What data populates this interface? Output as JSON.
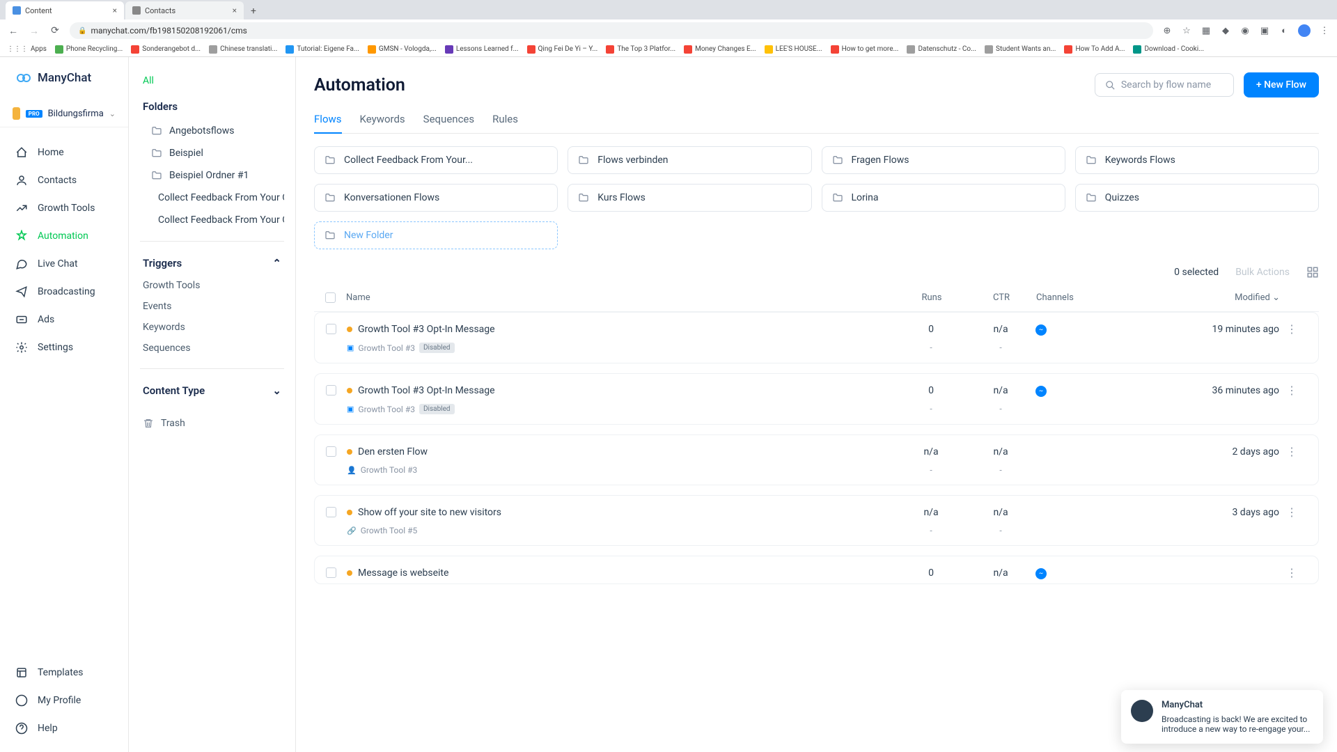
{
  "browser": {
    "tabs": [
      {
        "title": "Content",
        "active": true
      },
      {
        "title": "Contacts",
        "active": false
      }
    ],
    "url": "manychat.com/fb198150208192061/cms",
    "bookmarks": [
      {
        "label": "Apps",
        "color": "#5f6368"
      },
      {
        "label": "Phone Recycling...",
        "color": "#4CAF50"
      },
      {
        "label": "Sonderangebot d...",
        "color": "#f44336"
      },
      {
        "label": "Chinese translati...",
        "color": "#9e9e9e"
      },
      {
        "label": "Tutorial: Eigene Fa...",
        "color": "#2196F3"
      },
      {
        "label": "GMSN - Vologda,...",
        "color": "#ff9800"
      },
      {
        "label": "Lessons Learned f...",
        "color": "#673AB7"
      },
      {
        "label": "Qing Fei De Yi – Y...",
        "color": "#f44336"
      },
      {
        "label": "The Top 3 Platfor...",
        "color": "#f44336"
      },
      {
        "label": "Money Changes E...",
        "color": "#f44336"
      },
      {
        "label": "LEE'S HOUSE...",
        "color": "#ffc107"
      },
      {
        "label": "How to get more...",
        "color": "#f44336"
      },
      {
        "label": "Datenschutz - Co...",
        "color": "#9e9e9e"
      },
      {
        "label": "Student Wants an...",
        "color": "#9e9e9e"
      },
      {
        "label": "How To Add A...",
        "color": "#f44336"
      },
      {
        "label": "Download - Cooki...",
        "color": "#009688"
      }
    ]
  },
  "app": {
    "logo": "ManyChat",
    "workspace": {
      "name": "Bildungsfirma",
      "badge": "PRO"
    },
    "nav": [
      {
        "label": "Home",
        "icon": "home"
      },
      {
        "label": "Contacts",
        "icon": "contacts"
      },
      {
        "label": "Growth Tools",
        "icon": "growth"
      },
      {
        "label": "Automation",
        "icon": "automation",
        "active": true
      },
      {
        "label": "Live Chat",
        "icon": "chat"
      },
      {
        "label": "Broadcasting",
        "icon": "broadcast"
      },
      {
        "label": "Ads",
        "icon": "ads"
      },
      {
        "label": "Settings",
        "icon": "settings"
      }
    ],
    "nav_bottom": [
      {
        "label": "Templates",
        "icon": "templates"
      },
      {
        "label": "My Profile",
        "icon": "profile"
      },
      {
        "label": "Help",
        "icon": "help"
      }
    ]
  },
  "folder_bar": {
    "all": "All",
    "folders_heading": "Folders",
    "folders": [
      "Angebotsflows",
      "Beispiel",
      "Beispiel Ordner #1",
      "Collect Feedback From Your Cu",
      "Collect Feedback From Your Cu"
    ],
    "triggers_heading": "Triggers",
    "triggers": [
      "Growth Tools",
      "Events",
      "Keywords",
      "Sequences"
    ],
    "content_type_heading": "Content Type",
    "trash": "Trash"
  },
  "main": {
    "title": "Automation",
    "search_placeholder": "Search by flow name",
    "new_flow": "+ New Flow",
    "tabs": [
      "Flows",
      "Keywords",
      "Sequences",
      "Rules"
    ],
    "folder_cards": [
      "Collect Feedback From Your...",
      "Flows verbinden",
      "Fragen Flows",
      "Keywords Flows",
      "Konversationen Flows",
      "Kurs Flows",
      "Lorina",
      "Quizzes"
    ],
    "new_folder": "New Folder",
    "selected_text": "0 selected",
    "bulk_actions": "Bulk Actions",
    "columns": {
      "name": "Name",
      "runs": "Runs",
      "ctr": "CTR",
      "channels": "Channels",
      "modified": "Modified"
    },
    "flows": [
      {
        "name": "Growth Tool #3 Opt-In Message",
        "runs": "0",
        "ctr": "n/a",
        "channel": true,
        "modified": "19 minutes ago",
        "tag": "Growth Tool #3",
        "disabled": true,
        "tag_ic": "sq"
      },
      {
        "name": "Growth Tool #3 Opt-In Message",
        "runs": "0",
        "ctr": "n/a",
        "channel": true,
        "modified": "36 minutes ago",
        "tag": "Growth Tool #3",
        "disabled": true,
        "tag_ic": "sq"
      },
      {
        "name": "Den ersten Flow",
        "runs": "n/a",
        "ctr": "n/a",
        "channel": false,
        "modified": "2 days ago",
        "tag": "Growth Tool #3",
        "disabled": false,
        "tag_ic": "user"
      },
      {
        "name": "Show off your site to new visitors",
        "runs": "n/a",
        "ctr": "n/a",
        "channel": false,
        "modified": "3 days ago",
        "tag": "Growth Tool #5",
        "disabled": false,
        "tag_ic": "link"
      },
      {
        "name": "Message is webseite",
        "runs": "0",
        "ctr": "n/a",
        "channel": true,
        "modified": "",
        "tag": "",
        "disabled": false,
        "tag_ic": ""
      }
    ],
    "disabled_label": "Disabled"
  },
  "notification": {
    "title": "ManyChat",
    "body": "Broadcasting is back! We are excited to introduce a new way to re-engage your..."
  }
}
